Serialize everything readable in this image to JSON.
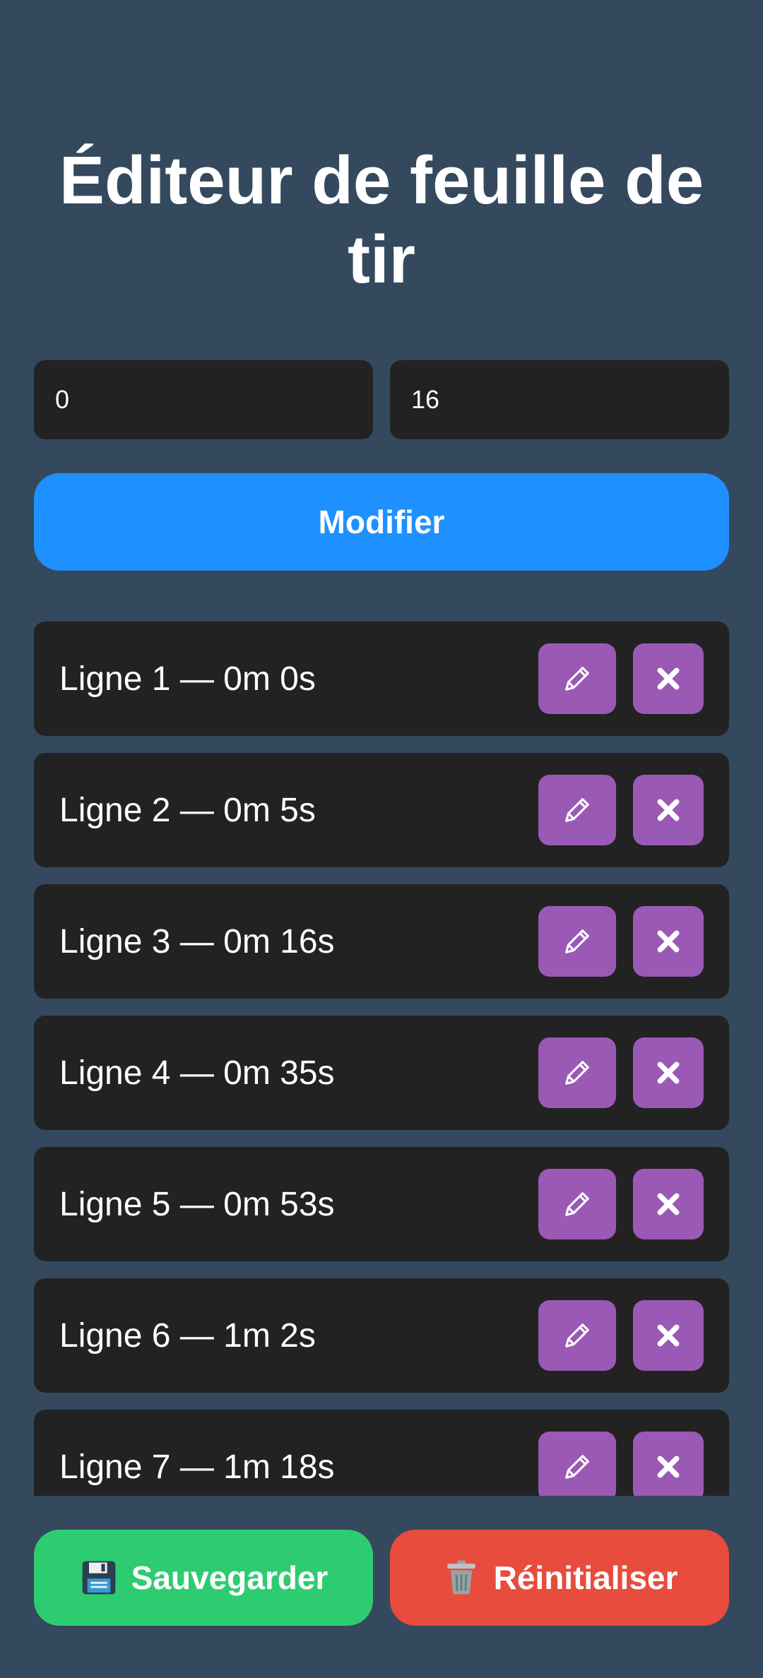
{
  "header": {
    "title": "Éditeur de feuille de tir"
  },
  "form": {
    "minutes_value": "0",
    "seconds_value": "16",
    "modify_label": "Modifier"
  },
  "rows": [
    {
      "label": "Ligne 1 — 0m 0s"
    },
    {
      "label": "Ligne 2 — 0m 5s"
    },
    {
      "label": "Ligne 3 — 0m 16s"
    },
    {
      "label": "Ligne 4 — 0m 35s"
    },
    {
      "label": "Ligne 5 — 0m 53s"
    },
    {
      "label": "Ligne 6 — 1m 2s"
    },
    {
      "label": "Ligne 7 — 1m 18s"
    }
  ],
  "row_icons": {
    "edit": "pencil-icon",
    "delete": "cross-icon"
  },
  "footer": {
    "save_label": "Sauvegarder",
    "save_icon": "floppy-disk-icon",
    "reset_label": "Réinitialiser",
    "reset_icon": "trash-icon"
  },
  "colors": {
    "background": "#34495e",
    "surface": "#222222",
    "primary": "#1e90ff",
    "action": "#9b59b6",
    "save": "#2ecc71",
    "reset": "#e74c3c"
  }
}
